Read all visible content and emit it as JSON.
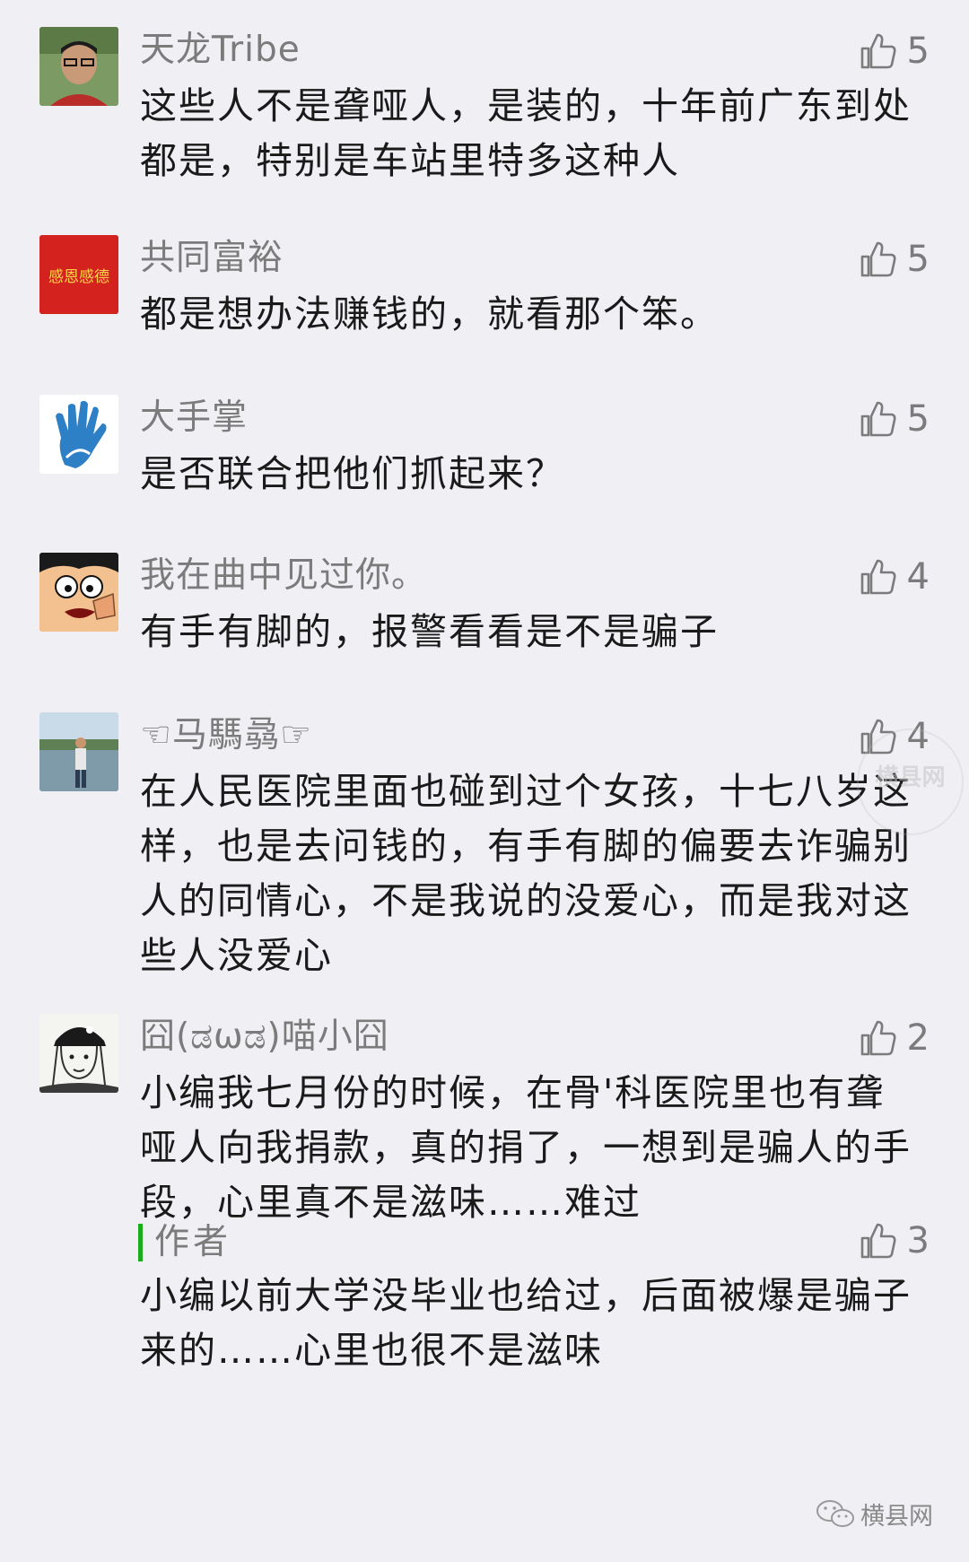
{
  "comments": [
    {
      "name": "天龙Tribe",
      "likes": "5",
      "text": "这些人不是聋哑人，是装的，十年前广东到处都是，特别是车站里特多这种人"
    },
    {
      "name": "共同富裕",
      "likes": "5",
      "avatar_text": "感恩感德",
      "text": "都是想办法赚钱的，就看那个笨。"
    },
    {
      "name": "大手掌",
      "likes": "5",
      "text": "是否联合把他们抓起来？"
    },
    {
      "name": "我在曲中见过你。",
      "likes": "4",
      "text": "有手有脚的，报警看看是不是骗子"
    },
    {
      "name": "☜马騳骉☞",
      "likes": "4",
      "text": "在人民医院里面也碰到过个女孩，十七八岁这样，也是去问钱的，有手有脚的偏要去诈骗别人的同情心，不是我说的没爱心，而是我对这些人没爱心"
    },
    {
      "name": "囧(ಡωಡ)喵小囧",
      "likes": "2",
      "text": "小编我七月份的时候，在骨'科医院里也有聋哑人向我捐款，真的捐了，一想到是骗人的手段，心里真不是滋味……难过",
      "reply": {
        "author": "作者",
        "likes": "3",
        "text": "小编以前大学没毕业也给过，后面被爆是骗子来的……心里也很不是滋味"
      }
    }
  ],
  "watermark": {
    "text": "横县网"
  },
  "brand": {
    "name": "横县网"
  },
  "colors": {
    "background": "#efeff4",
    "name": "#7b7b7b",
    "text": "#1a1a1a",
    "author_bar": "#1aad19"
  }
}
